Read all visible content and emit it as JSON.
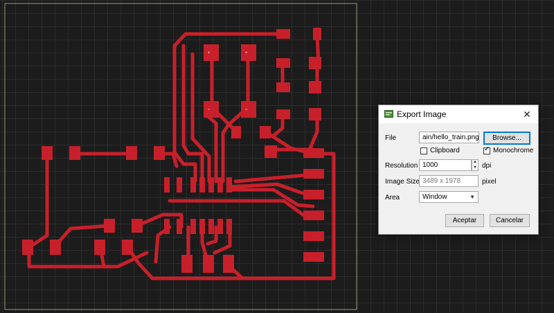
{
  "dialog": {
    "title": "Export Image",
    "close_icon": "close-icon",
    "file_label": "File",
    "file_value": "ain/hello_train.png",
    "browse_label": "Browse...",
    "clipboard_label": "Clipboard",
    "clipboard_checked": false,
    "monochrome_label": "Monochrome",
    "monochrome_checked": true,
    "resolution_label": "Resolution",
    "resolution_value": "1000",
    "resolution_unit": "dpi",
    "image_size_label": "Image Size",
    "image_size_value": "3489 x 1978",
    "image_size_unit": "pixel",
    "area_label": "Area",
    "area_value": "Window",
    "accept_label": "Aceptar",
    "cancel_label": "Cancelar"
  },
  "colors": {
    "trace": "#c8202b",
    "background": "#1c1c1c",
    "grid": "#3a3a3a",
    "board_outline": "#9a9a78"
  }
}
